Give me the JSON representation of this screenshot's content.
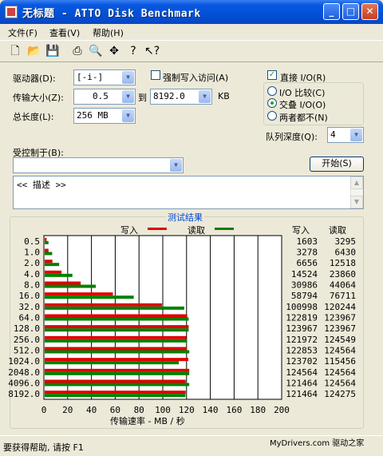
{
  "window": {
    "title": "无标题 - ATTO Disk Benchmark",
    "watermark": "com"
  },
  "menu": [
    "文件(F)",
    "查看(V)",
    "帮助(H)"
  ],
  "toolbar": [
    "new-icon",
    "open-icon",
    "save-icon",
    "print-icon",
    "print-preview-icon",
    "move-icon",
    "help-icon",
    "context-help-icon"
  ],
  "form": {
    "drive_label": "驱动器(D):",
    "drive_value": "[-i-]",
    "force_write_label": "强制写入访问(A)",
    "direct_io_label": "直接 I/O(R)",
    "transfer_label": "传输大小(Z):",
    "transfer_from": "0.5",
    "to_label": "到",
    "transfer_to": "8192.0",
    "unit_kb": "KB",
    "total_label": "总长度(L):",
    "total_value": "256 MB",
    "radio_io_compare": "I/O 比较(C)",
    "radio_overlap": "交叠 I/O(O)",
    "radio_neither": "两者都不(N)",
    "queue_label": "队列深度(Q):",
    "queue_value": "4",
    "controlled_label": "受控制于(B):",
    "controlled_value": "",
    "start_button": "开始(S)",
    "description": "<< 描述 >>"
  },
  "results": {
    "title": "测试结果",
    "legend_write": "写入",
    "legend_read": "读取",
    "col_write": "写入",
    "col_read": "读取",
    "axis_label": "传输速率 - MB / 秒"
  },
  "status": {
    "help": "要获得帮助, 请按 F1",
    "brand": "MyDrivers.com 驱动之家"
  },
  "colors": {
    "write": "#e00000",
    "read": "#008000",
    "accent": "#0046d5"
  },
  "chart_data": {
    "type": "bar",
    "orientation": "horizontal",
    "categories": [
      "0.5",
      "1.0",
      "2.0",
      "4.0",
      "8.0",
      "16.0",
      "32.0",
      "64.0",
      "128.0",
      "256.0",
      "512.0",
      "1024.0",
      "2048.0",
      "4096.0",
      "8192.0"
    ],
    "series": [
      {
        "name": "写入",
        "values": [
          1.6,
          3.2,
          6.5,
          14.2,
          30.3,
          57.4,
          98.6,
          119.9,
          121.1,
          119.1,
          119.6,
          120.8,
          121.6,
          118.6,
          118.6
        ],
        "color": "#e00000"
      },
      {
        "name": "读取",
        "values": [
          3.2,
          6.3,
          12.2,
          23.3,
          43.0,
          74.9,
          117.4,
          121.1,
          121.1,
          119.7,
          121.6,
          112.8,
          121.6,
          121.6,
          118.4
        ],
        "color": "#008000"
      }
    ],
    "write_kbps": [
      "1603",
      "3278",
      "6656",
      "14524",
      "30986",
      "58794",
      "100998",
      "122819",
      "123967",
      "121972",
      "122853",
      "123702",
      "124564",
      "121464",
      "121464"
    ],
    "read_kbps": [
      "3295",
      "6430",
      "12518",
      "23860",
      "44064",
      "76711",
      "120244",
      "123967",
      "123967",
      "124549",
      "124564",
      "115456",
      "124564",
      "124564",
      "124275"
    ],
    "xticks": [
      "0",
      "20",
      "40",
      "60",
      "80",
      "100",
      "120",
      "140",
      "160",
      "180",
      "200"
    ],
    "xlim": [
      0,
      200
    ],
    "xlabel": "传输速率 - MB / 秒",
    "grid": true
  }
}
